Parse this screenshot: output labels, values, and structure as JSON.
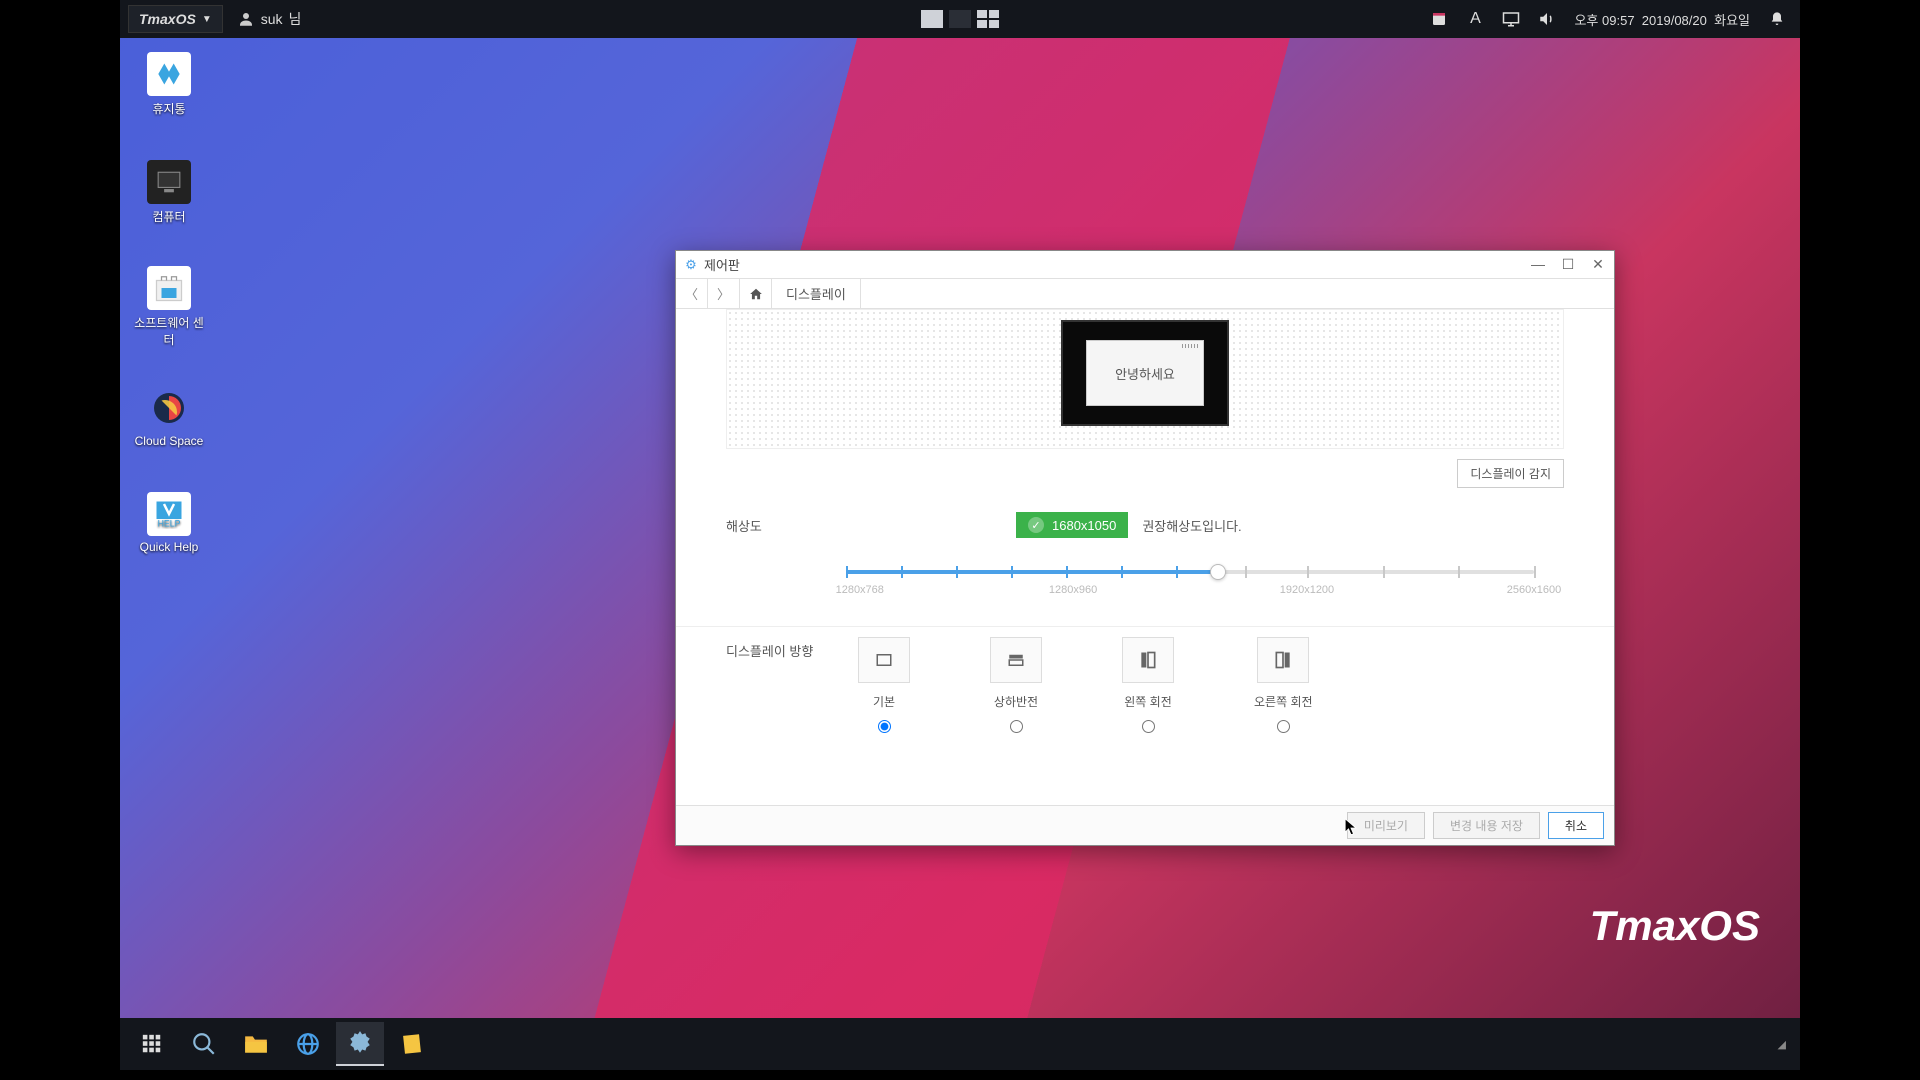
{
  "os": {
    "name": "TmaxOS",
    "brand": "TmaxOS"
  },
  "user": {
    "name": "suk",
    "suffix": "님"
  },
  "clock": {
    "ampm": "오후",
    "time": "09:57",
    "date": "2019/08/20",
    "weekday": "화요일"
  },
  "desktop_icons": [
    {
      "label": "휴지통"
    },
    {
      "label": "컴퓨터"
    },
    {
      "label": "소프트웨어 센터"
    },
    {
      "label": "Cloud Space"
    },
    {
      "label": "Quick Help"
    }
  ],
  "window": {
    "title": "제어판",
    "breadcrumb": "디스플레이",
    "preview_greeting": "안녕하세요",
    "detect_btn": "디스플레이 감지",
    "resolution": {
      "label": "해상도",
      "current": "1680x1050",
      "note": "권장해상도입니다.",
      "ticks": [
        "1280x768",
        "1280x960",
        "1920x1200",
        "2560x1600"
      ]
    },
    "orientation": {
      "label": "디스플레이 방향",
      "options": [
        "기본",
        "상하반전",
        "왼쪽 회전",
        "오른쪽 회전"
      ]
    },
    "buttons": {
      "preview": "미리보기",
      "save": "변경 내용 저장",
      "cancel": "취소"
    }
  }
}
